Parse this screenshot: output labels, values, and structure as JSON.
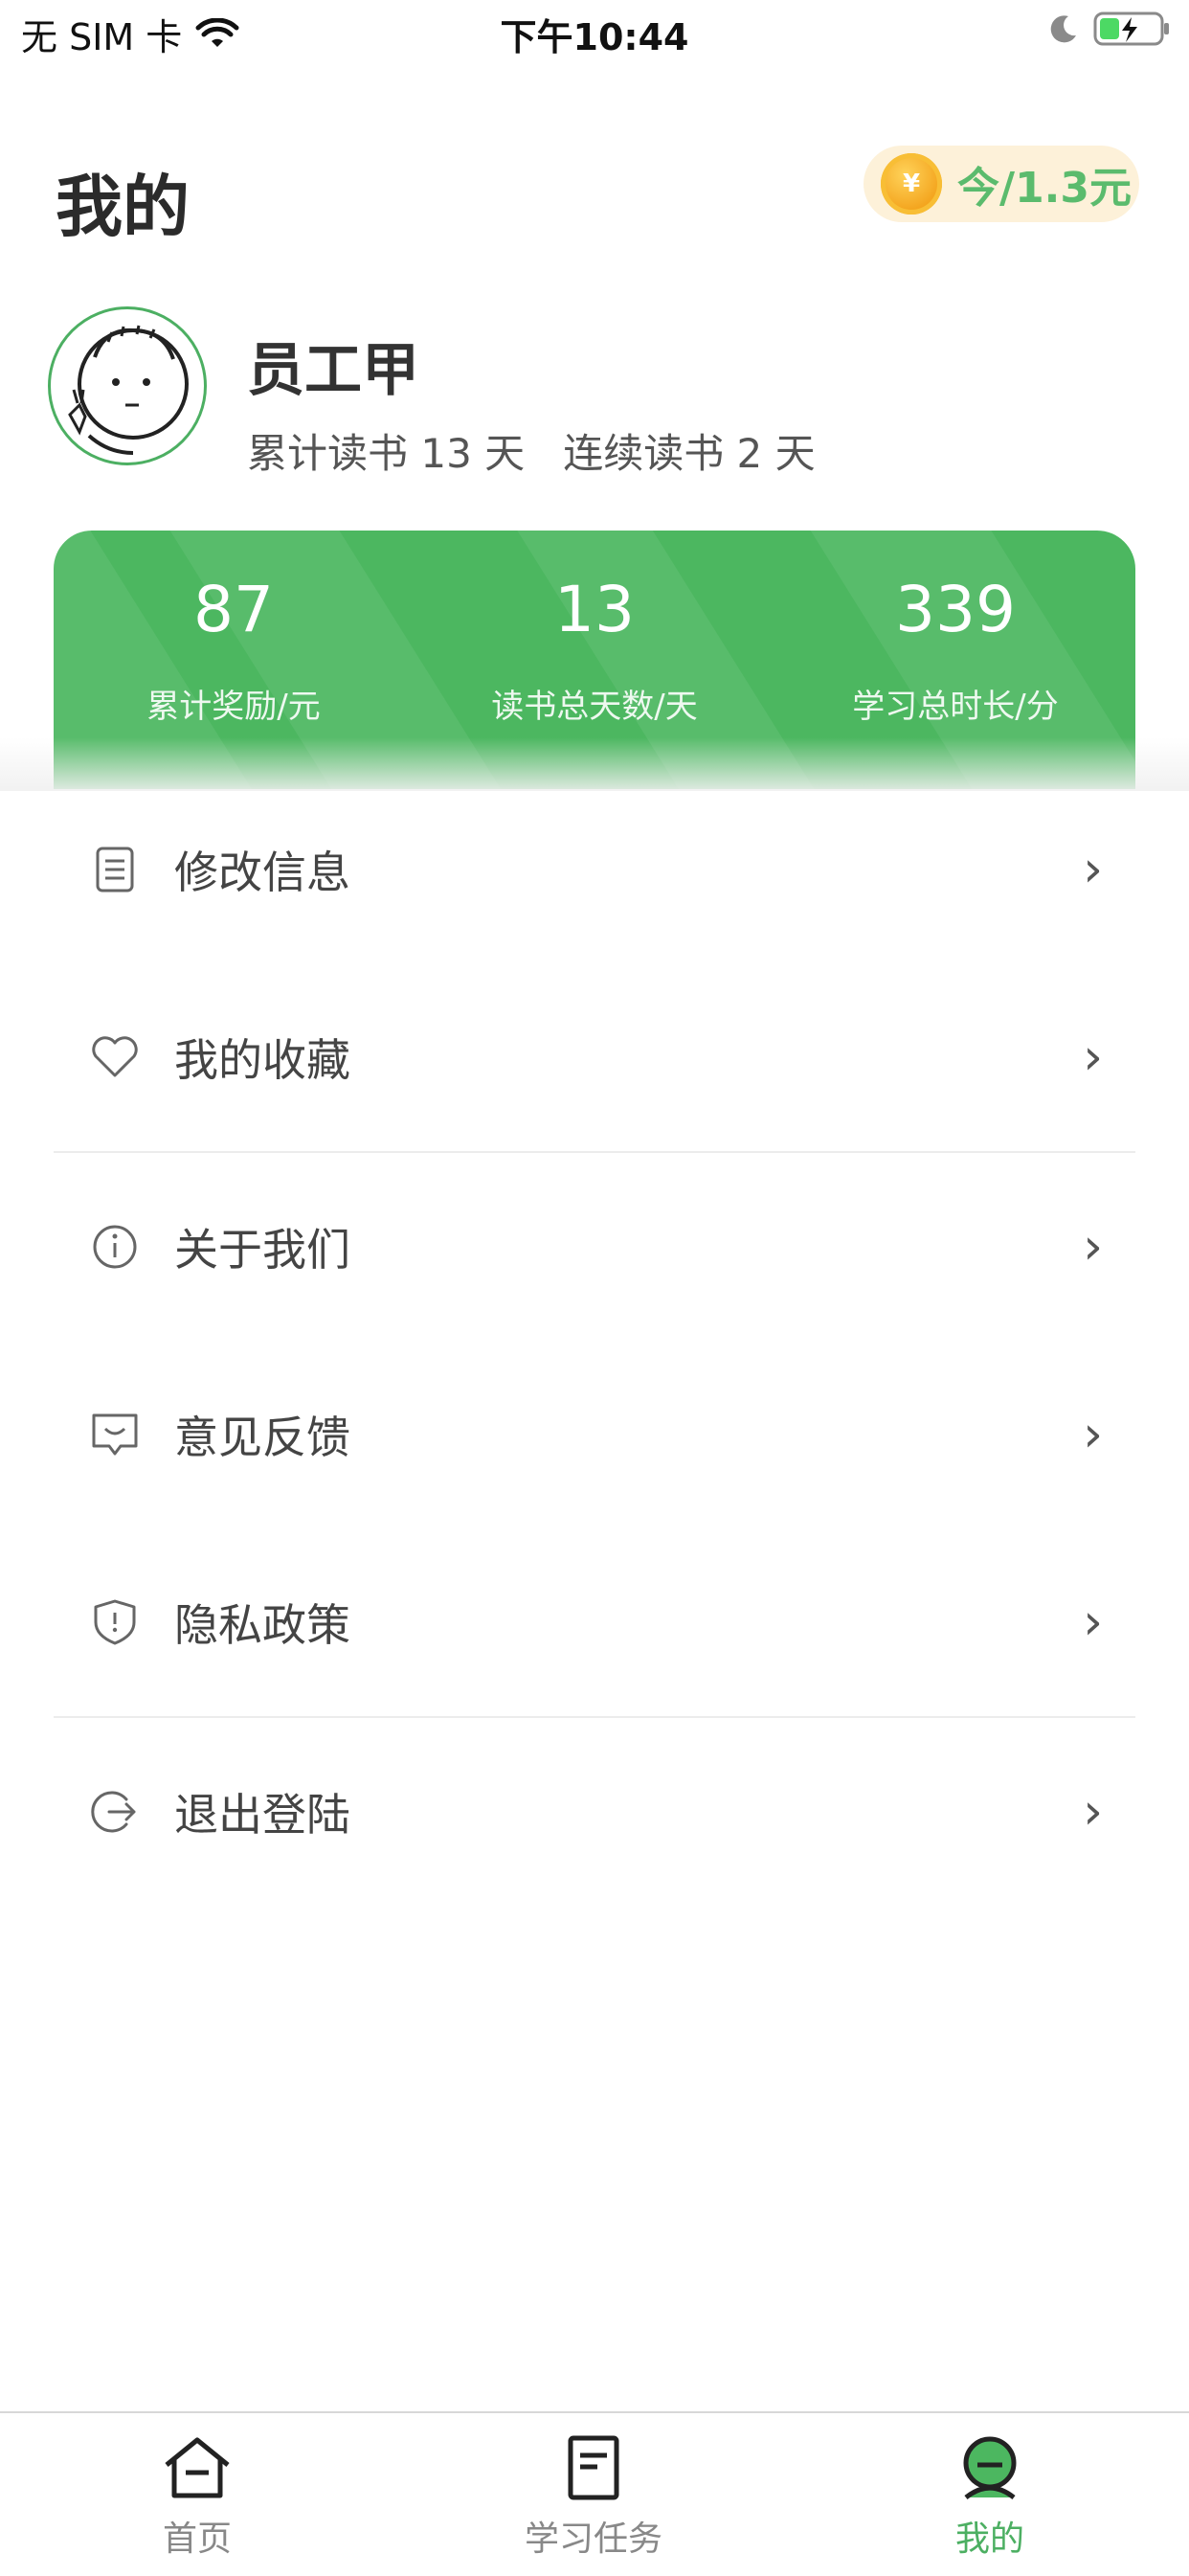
{
  "status_bar": {
    "carrier": "无 SIM 卡",
    "time": "下午10:44"
  },
  "header": {
    "title": "我的",
    "earnings_badge": "今/1.3元",
    "coin_symbol": "¥"
  },
  "profile": {
    "name": "员工甲",
    "stats_line": "累计读书 13 天   连续读书 2 天"
  },
  "stats": [
    {
      "value": "87",
      "label": "累计奖励/元"
    },
    {
      "value": "13",
      "label": "读书总天数/天"
    },
    {
      "value": "339",
      "label": "学习总时长/分"
    }
  ],
  "menu": [
    {
      "label": "修改信息",
      "icon": "document-icon"
    },
    {
      "label": "我的收藏",
      "icon": "heart-icon"
    },
    {
      "label": "关于我们",
      "icon": "info-icon"
    },
    {
      "label": "意见反馈",
      "icon": "feedback-icon"
    },
    {
      "label": "隐私政策",
      "icon": "shield-icon"
    },
    {
      "label": "退出登陆",
      "icon": "logout-icon"
    }
  ],
  "tabs": [
    {
      "label": "首页",
      "icon": "home-icon"
    },
    {
      "label": "学习任务",
      "icon": "task-icon"
    },
    {
      "label": "我的",
      "icon": "profile-icon",
      "active": true
    }
  ],
  "colors": {
    "accent_green": "#4cb760",
    "badge_bg": "#fdf1d9",
    "badge_text": "#5bbb6d"
  }
}
